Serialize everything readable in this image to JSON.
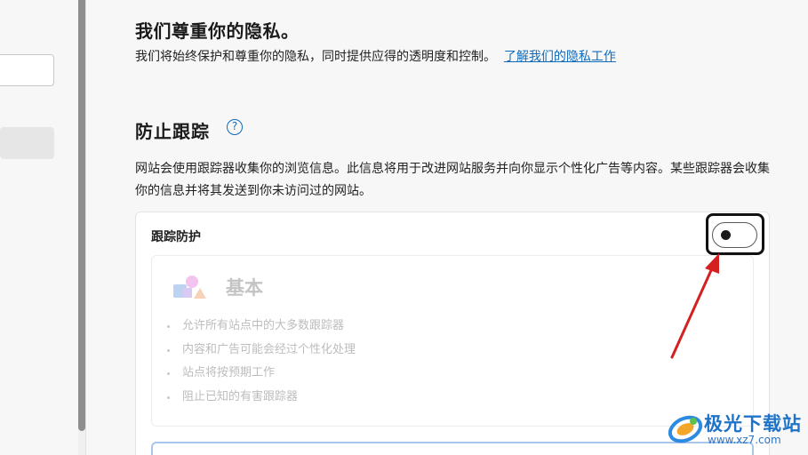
{
  "privacy": {
    "title": "我们尊重你的隐私。",
    "description": "我们将始终保护和尊重你的隐私，同时提供应得的透明度和控制。",
    "link_text": "了解我们的隐私工作"
  },
  "tracking": {
    "title": "防止跟踪",
    "help_icon": "question-circle-icon",
    "description": "网站会使用跟踪器收集你的浏览信息。此信息将用于改进网站服务并向你显示个性化广告等内容。某些跟踪器会收集你的信息并将其发送到你未访问过的网站。"
  },
  "protection_card": {
    "title": "跟踪防护",
    "toggle_state": "off",
    "options": [
      {
        "label": "基本",
        "icon": "shapes-icon",
        "features": [
          "允许所有站点中的大多数跟踪器",
          "内容和广告可能会经过个性化处理",
          "站点将按预期工作",
          "阻止已知的有害跟踪器"
        ]
      }
    ]
  },
  "watermark": {
    "title": "极光下载站",
    "url": "www.xz7.com"
  },
  "colors": {
    "accent": "#0f6cbd",
    "annotation": "#d42020",
    "disabled_text": "#bdbdbd"
  }
}
